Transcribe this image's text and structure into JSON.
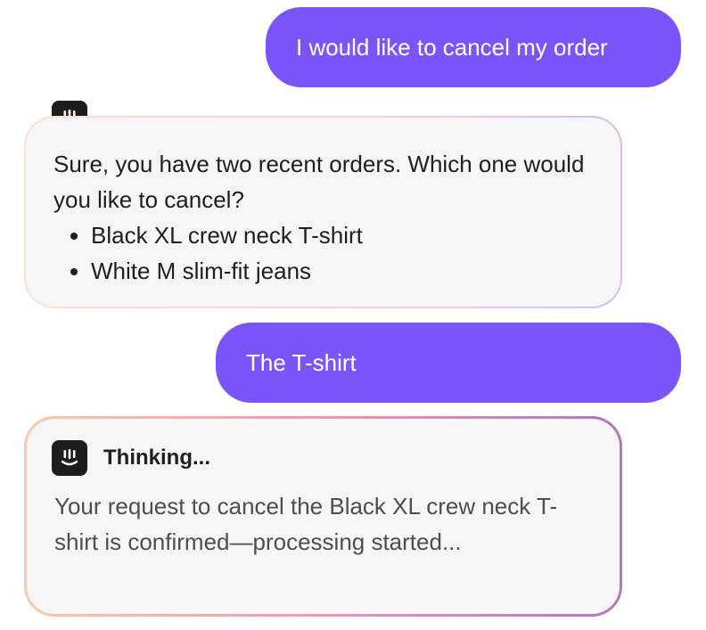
{
  "messages": {
    "user_1": "I would like to cancel my order",
    "bot_1": {
      "intro": "Sure, you have two recent orders. Which one would you like to cancel?",
      "items": [
        "Black XL crew neck T-shirt",
        "White M slim-fit jeans"
      ]
    },
    "user_2": "The T-shirt",
    "bot_2": {
      "status": "Thinking...",
      "text": "Your request to cancel the Black XL crew neck T-shirt is confirmed—processing started..."
    }
  },
  "icons": {
    "bot_avatar": "smiley-bot-icon"
  },
  "colors": {
    "user_bubble": "#7b55f9",
    "bot_bubble": "#f6f6f6",
    "bot_avatar_bg": "#1d1d1d"
  }
}
